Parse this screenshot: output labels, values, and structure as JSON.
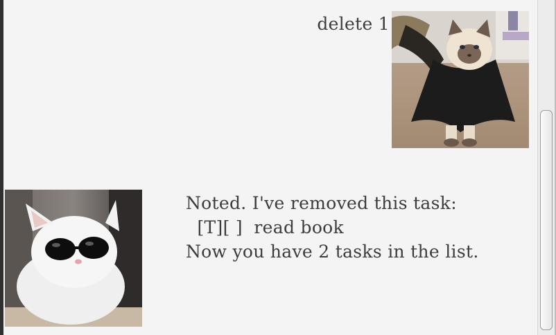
{
  "dialog": {
    "user_message": "delete 1",
    "bot_message_lines": [
      "Noted. I've removed this task:",
      "  [T][ ]  read book",
      "Now you have 2 tasks in the list."
    ]
  },
  "avatars": {
    "user": "siamese-cat-in-cape-photo",
    "bot": "white-cat-with-sunglasses-photo"
  },
  "scrollbar": {
    "position_fraction": 0.55
  }
}
